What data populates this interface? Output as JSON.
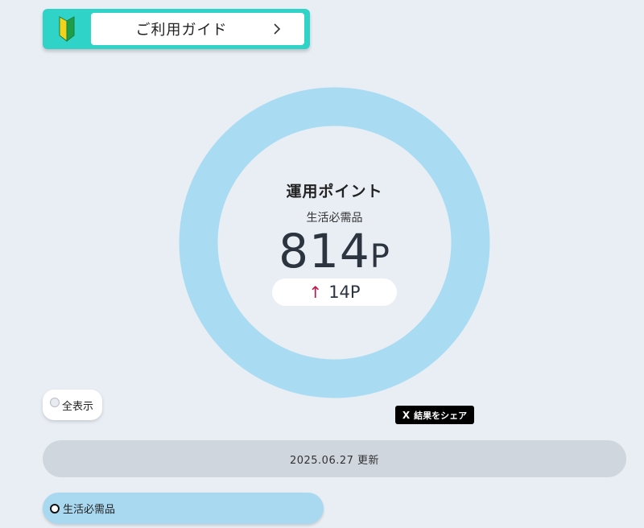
{
  "guide": {
    "label": "ご利用ガイド",
    "chevron": ">"
  },
  "donut": {
    "title": "運用ポイント",
    "category": "生活必需品",
    "points_value": "814",
    "points_unit": "P",
    "diff_arrow": "↑",
    "diff_value": "14P",
    "ring_color": "#a9dcf3"
  },
  "filters": {
    "show_all_label": "全表示"
  },
  "share": {
    "label": "結果をシェア",
    "icon": "X"
  },
  "update": {
    "text": "2025.06.27 更新"
  },
  "category_chip": {
    "label": "生活必需品"
  }
}
